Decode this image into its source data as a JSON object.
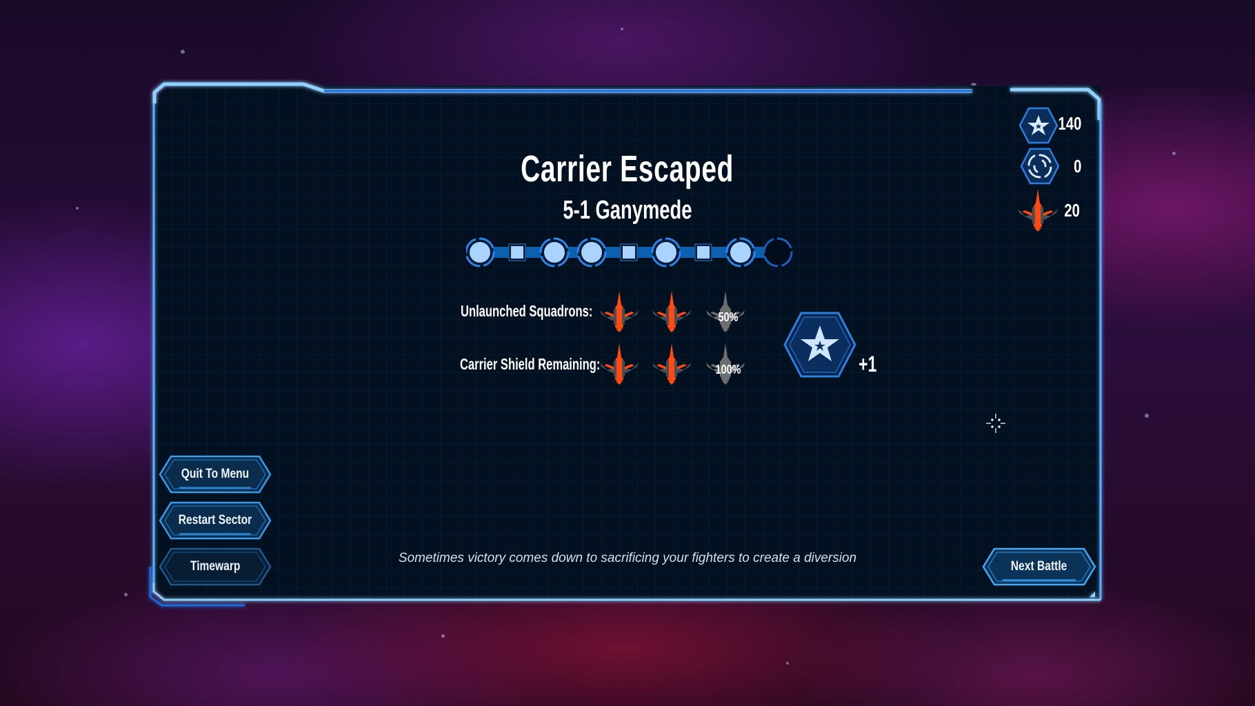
{
  "result": {
    "title": "Carrier Escaped",
    "subtitle": "5-1 Ganymede"
  },
  "progress_track": {
    "nodes": [
      {
        "type": "circle",
        "state": "completed"
      },
      {
        "type": "square",
        "state": "completed"
      },
      {
        "type": "circle",
        "state": "completed"
      },
      {
        "type": "circle",
        "state": "completed"
      },
      {
        "type": "square",
        "state": "completed"
      },
      {
        "type": "circle",
        "state": "completed"
      },
      {
        "type": "square",
        "state": "completed"
      },
      {
        "type": "circle",
        "state": "completed"
      },
      {
        "type": "circle",
        "state": "locked"
      }
    ]
  },
  "objectives": [
    {
      "label": "Unlaunched Squadrons:",
      "ships": [
        {
          "state": "earned",
          "icon": "fighter-icon"
        },
        {
          "state": "earned",
          "icon": "fighter-icon"
        },
        {
          "state": "unearned",
          "icon": "fighter-icon",
          "text": "50%"
        }
      ]
    },
    {
      "label": "Carrier Shield Remaining:",
      "ships": [
        {
          "state": "earned",
          "icon": "fighter-icon"
        },
        {
          "state": "earned",
          "icon": "fighter-icon"
        },
        {
          "state": "unearned",
          "icon": "fighter-icon",
          "text": "100%"
        }
      ]
    }
  ],
  "reward": {
    "icon": "star-hex-icon",
    "text": "+1"
  },
  "resources": [
    {
      "icon": "star-hex-icon",
      "value": "140"
    },
    {
      "icon": "vortex-hex-icon",
      "value": "0"
    },
    {
      "icon": "fighter-icon",
      "value": "20"
    }
  ],
  "menu": {
    "quit": "Quit To Menu",
    "restart": "Restart Sector",
    "timewarp": "Timewarp",
    "next": "Next Battle"
  },
  "tip": "Sometimes victory comes down to sacrificing your fighters to create a diversion",
  "colors": {
    "frame": "#7cc4ff",
    "accent": "#1a6fd0",
    "node_fill": "#a8d4ff",
    "ship_orange": "#ff4a12",
    "ship_gray": "#4a4e54",
    "ship_unearned": "#6c6e70",
    "panel_bg": "#02101f"
  }
}
